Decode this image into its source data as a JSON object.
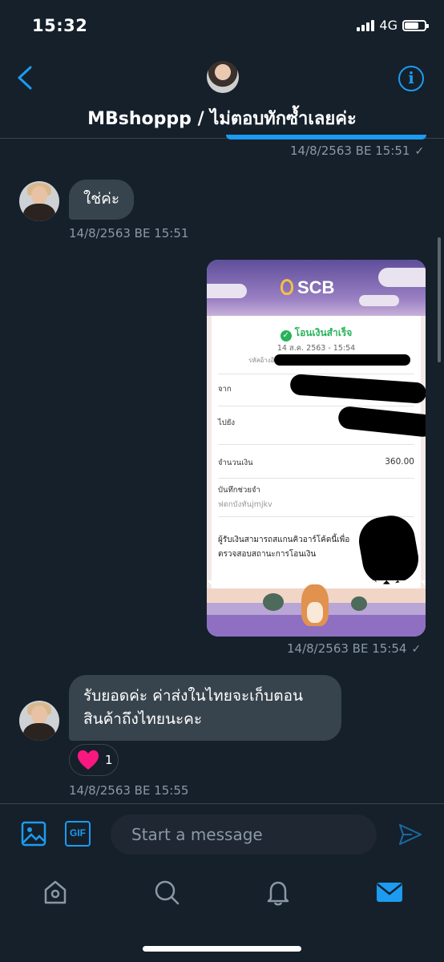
{
  "status_bar": {
    "time": "15:32",
    "network": "4G",
    "battery_level": 0.7
  },
  "header": {
    "title": "MBshoppp / ไม่ตอบทักซ้ำเลยค่ะ",
    "back_icon": "chevron-left-icon",
    "info_icon": "info-icon"
  },
  "messages": [
    {
      "direction": "out",
      "timestamp": "14/8/2563 BE 15:51",
      "seen": "✓"
    },
    {
      "direction": "in",
      "text": "ใช่ค่ะ",
      "timestamp": "14/8/2563 BE 15:51"
    },
    {
      "direction": "out",
      "type": "image",
      "timestamp": "14/8/2563 BE 15:54",
      "seen": "✓",
      "image": {
        "brand": "SCB",
        "status": "โอนเงินสำเร็จ",
        "date": "14 ส.ค. 2563 - 15:54",
        "ref_label": "รหัสอ้างอิง",
        "from_label": "จาก",
        "to_label": "ไปยัง",
        "amount_label": "จำนวนเงิน",
        "amount": "360.00",
        "memo_label": "บันทึกช่วยจำ",
        "memo": "ฟดกบังทันjmjkv",
        "qr_note_line1": "ผู้รับเงินสามารถสแกนคิวอาร์โค้ดนี้เพื่อ",
        "qr_note_line2": "ตรวจสอบสถานะการโอนเงิน"
      }
    },
    {
      "direction": "in",
      "line1": "รับยอดค่ะ ค่าส่งในไทยจะเก็บตอน",
      "line2": "สินค้าถึงไทยนะคะ",
      "timestamp": "14/8/2563 BE 15:55",
      "reaction": {
        "emoji": "heart",
        "count": "1"
      }
    }
  ],
  "composer": {
    "placeholder": "Start a message",
    "gif_label": "GIF"
  },
  "tab_bar": [
    "home-icon",
    "search-icon",
    "notifications-icon",
    "messages-icon"
  ],
  "colors": {
    "background": "#15202b",
    "accent": "#1d9bf0",
    "bubble_in": "#38444d",
    "muted": "#8b98a5",
    "heart": "#f91880"
  }
}
